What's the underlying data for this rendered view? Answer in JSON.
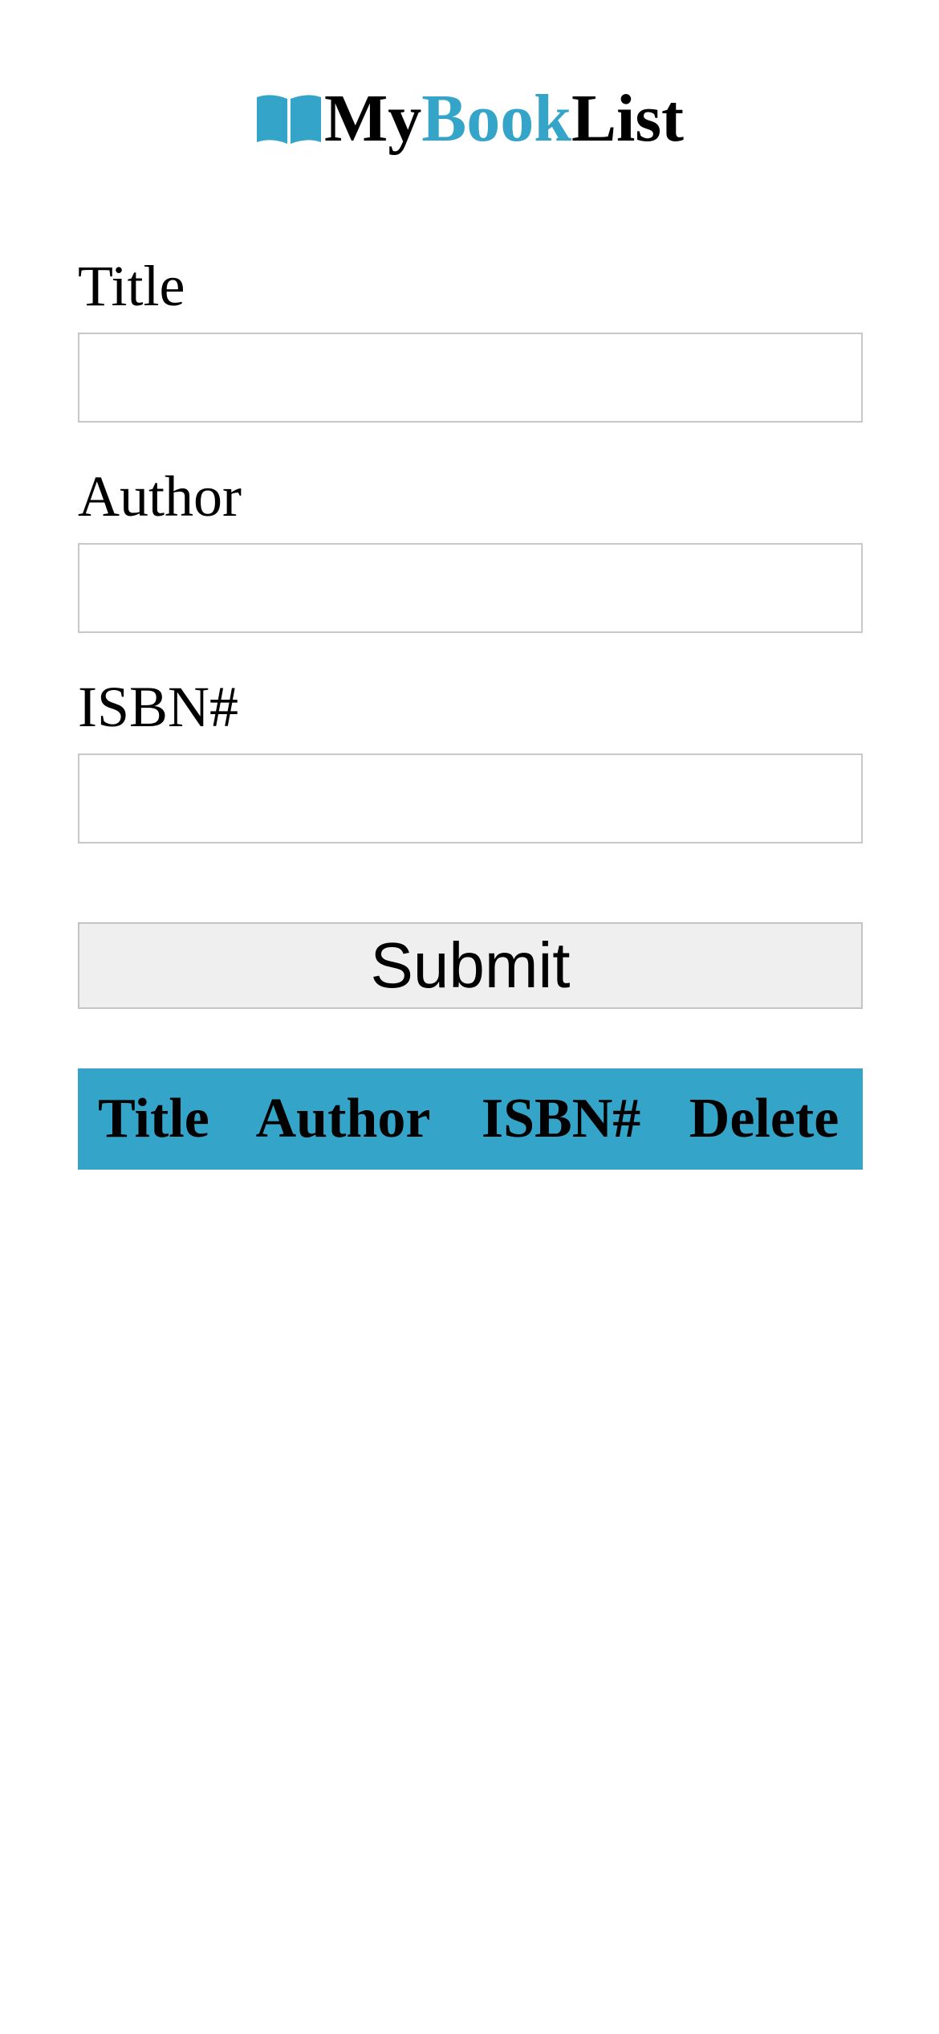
{
  "header": {
    "logo_icon": "open-book-icon",
    "title_part1": "My",
    "title_part2": "Book",
    "title_part3": "List"
  },
  "form": {
    "title_label": "Title",
    "title_value": "",
    "author_label": "Author",
    "author_value": "",
    "isbn_label": "ISBN#",
    "isbn_value": "",
    "submit_label": "Submit"
  },
  "table": {
    "headers": [
      "Title",
      "Author",
      "ISBN#",
      "Delete"
    ]
  },
  "colors": {
    "accent": "#35a4c9",
    "button_bg": "#efefef",
    "input_border": "#c8c8c8"
  }
}
